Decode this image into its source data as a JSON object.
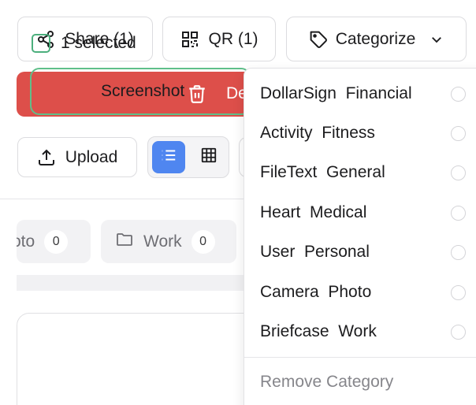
{
  "toolbar": {
    "share_label": "Share (1)",
    "qr_label": "QR (1)",
    "categorize_label": "Categorize",
    "delete_label": "De",
    "upload_label": "Upload"
  },
  "view_toggle": {
    "active": "list"
  },
  "filter_chips": [
    {
      "label": "oto",
      "count": "0"
    },
    {
      "label": "Work",
      "count": "0"
    }
  ],
  "selection": {
    "label": "1 selected",
    "file_name_partial": "Screenshot"
  },
  "category_menu": {
    "options": [
      {
        "icon": "DollarSign",
        "label": "Financial"
      },
      {
        "icon": "Activity",
        "label": "Fitness"
      },
      {
        "icon": "FileText",
        "label": "General"
      },
      {
        "icon": "Heart",
        "label": "Medical"
      },
      {
        "icon": "User",
        "label": "Personal"
      },
      {
        "icon": "Camera",
        "label": "Photo"
      },
      {
        "icon": "Briefcase",
        "label": "Work"
      }
    ],
    "remove_label": "Remove Category"
  },
  "colors": {
    "delete_bg": "#dd4f4a",
    "view_active_bg": "#4f86f0",
    "selected_border": "#5fbf8a"
  }
}
